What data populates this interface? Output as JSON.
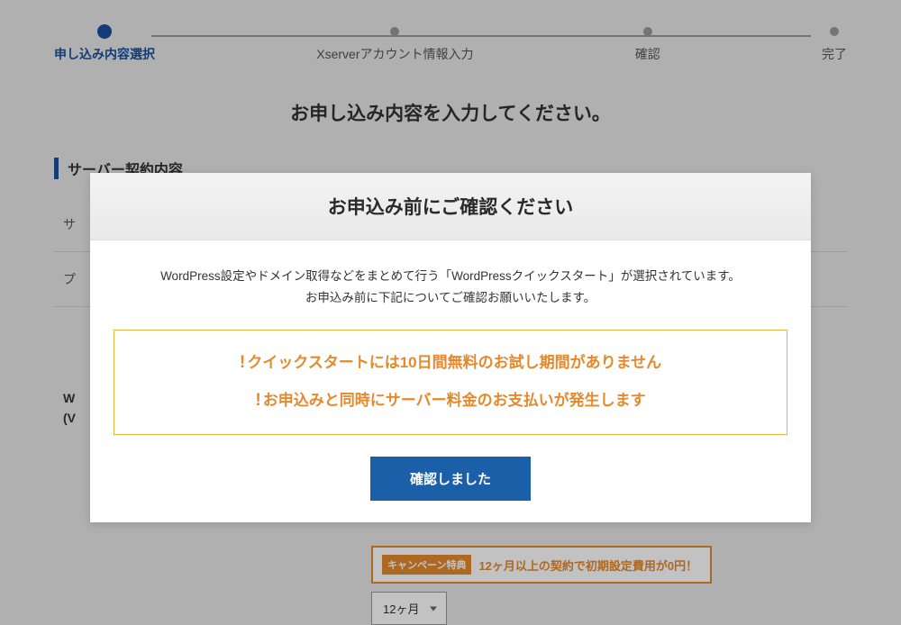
{
  "stepper": {
    "steps": [
      {
        "label": "申し込み内容選択",
        "active": true
      },
      {
        "label": "Xserverアカウント情報入力",
        "active": false
      },
      {
        "label": "確認",
        "active": false
      },
      {
        "label": "完了",
        "active": false
      }
    ]
  },
  "heading_main": "お申し込み内容を入力してください。",
  "section_title": "サーバー契約内容",
  "field_rows": {
    "r1": "サ",
    "r2": "プ"
  },
  "wp_label_line1": "W",
  "wp_label_line2": "(V",
  "campaign": {
    "badge": "キャンペーン特典",
    "text": "12ヶ月以上の契約で初期設定費用が0円！"
  },
  "select": {
    "value": "12ヶ月"
  },
  "modal": {
    "title": "お申込み前にご確認ください",
    "desc_line1": "WordPress設定やドメイン取得などをまとめて行う「WordPressクイックスタート」が選択されています。",
    "desc_line2": "お申込み前に下記についてご確認お願いいたします。",
    "warning1": "クイックスタートには10日間無料のお試し期間がありません",
    "warning2": "お申込みと同時にサーバー料金のお支払いが発生します",
    "confirm_label": "確認しました"
  }
}
